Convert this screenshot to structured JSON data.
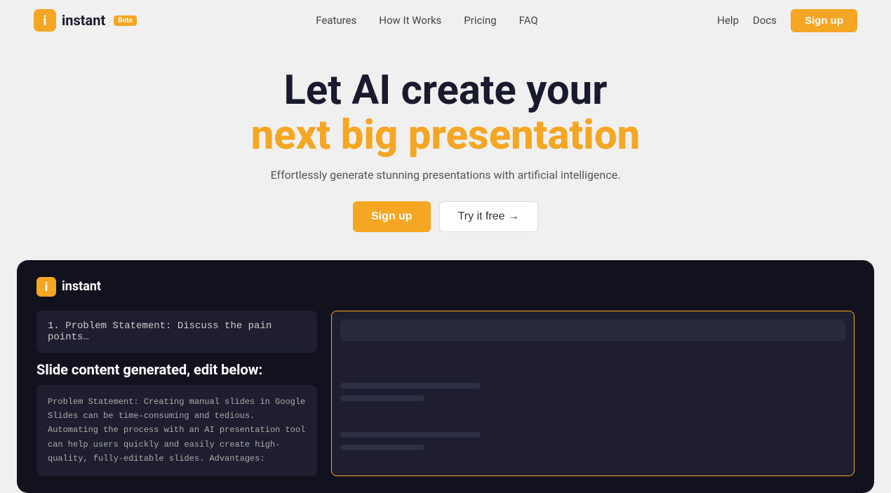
{
  "brand": {
    "name": "instant",
    "beta_label": "Beta"
  },
  "nav": {
    "links": [
      {
        "id": "features",
        "label": "Features"
      },
      {
        "id": "how-it-works",
        "label": "How It Works"
      },
      {
        "id": "pricing",
        "label": "Pricing"
      },
      {
        "id": "faq",
        "label": "FAQ"
      }
    ],
    "right_links": [
      {
        "id": "help",
        "label": "Help"
      },
      {
        "id": "docs",
        "label": "Docs"
      }
    ],
    "signup_label": "Sign up"
  },
  "hero": {
    "title_line1": "Let AI create your",
    "title_line2": "next big presentation",
    "subtitle": "Effortlessly generate stunning presentations with artificial intelligence.",
    "btn_signup": "Sign up",
    "btn_try_free": "Try it free →"
  },
  "demo": {
    "logo_text": "instant",
    "input_text": "1. Problem Statement: Discuss the pain points…",
    "generated_label": "Slide content generated, edit below:",
    "content_text": "Problem Statement:\nCreating manual slides in Google Slides can be time-consuming and tedious. Automating the process with an AI presentation tool can help users quickly and easily create high-quality, fully-editable slides.\n\nAdvantages:"
  }
}
